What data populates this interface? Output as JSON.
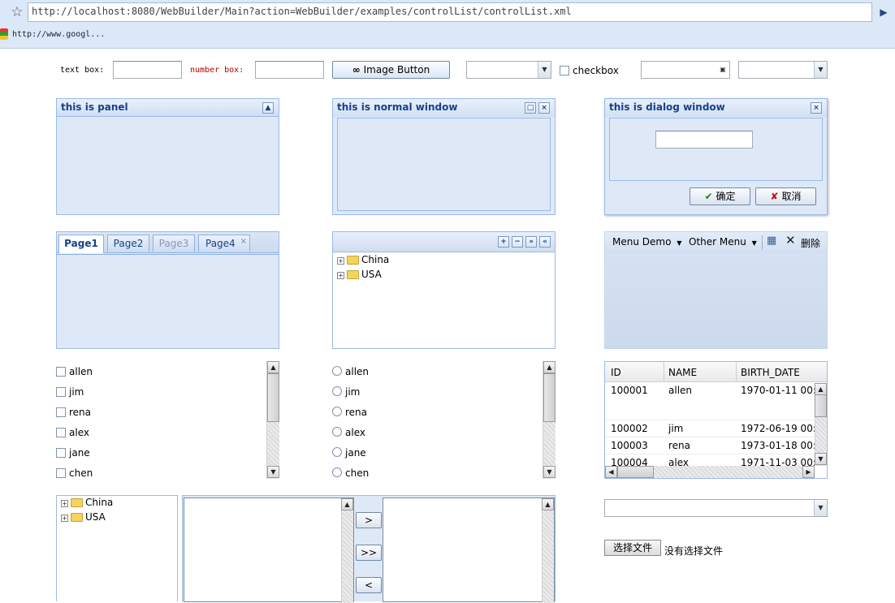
{
  "browser": {
    "url": "http://localhost:8080/WebBuilder/Main?action=WebBuilder/examples/controlList/controlList.xml",
    "bookmark": "http://www.googl..."
  },
  "form": {
    "text_box_label": "text box:",
    "number_box_label": "number box:",
    "image_button_label": "Image Button",
    "checkbox_label": "checkbox"
  },
  "panels": {
    "panel_title": "this is panel",
    "window_title": "this is normal window",
    "dialog_title": "this is dialog window",
    "dialog_ok": "确定",
    "dialog_cancel": "取消"
  },
  "tabs": [
    "Page1",
    "Page2",
    "Page3",
    "Page4"
  ],
  "tree": [
    "China",
    "USA"
  ],
  "menu": {
    "menu_demo": "Menu Demo",
    "other_menu": "Other Menu",
    "delete": "删除"
  },
  "list_items": [
    "allen",
    "jim",
    "rena",
    "alex",
    "jane",
    "chen"
  ],
  "grid": {
    "columns": [
      "ID",
      "NAME",
      "BIRTH_DATE"
    ],
    "rows": [
      {
        "id": "100001",
        "name": "allen",
        "date": "1970-01-11 00:0"
      },
      {
        "id": "100002",
        "name": "jim",
        "date": "1972-06-19 00:0"
      },
      {
        "id": "100003",
        "name": "rena",
        "date": "1973-01-18 00:0"
      },
      {
        "id": "100004",
        "name": "alex",
        "date": "1971-11-03 00:0"
      }
    ]
  },
  "swap_buttons": [
    ">",
    ">>",
    "<"
  ],
  "file": {
    "button": "选择文件",
    "status": "没有选择文件"
  },
  "colors": {
    "panel_border": "#99bbe8",
    "panel_bg": "#dfe8f6",
    "title_text": "#15428b",
    "number_label": "#b00000"
  }
}
